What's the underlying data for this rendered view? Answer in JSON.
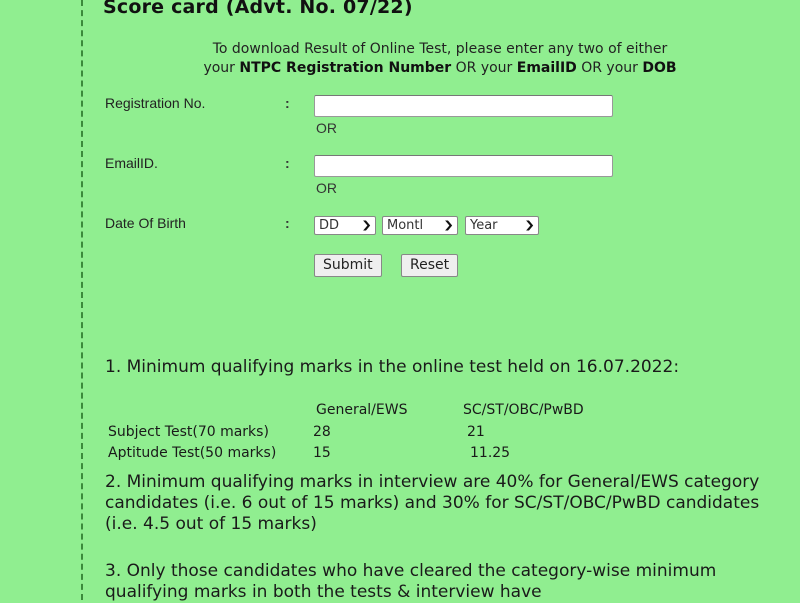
{
  "page": {
    "title": "Score card (Advt. No. 07/22)",
    "background_color": "#90ee90"
  },
  "instructions": {
    "line1": "To download Result of Online Test, please enter any two of either",
    "line2_parts": [
      "your ",
      "NTPC Registration Number",
      " OR your ",
      "EmailID",
      " OR your ",
      "DOB"
    ]
  },
  "form": {
    "registration": {
      "label": "Registration No.",
      "colon": ":",
      "value": "",
      "or": "OR"
    },
    "email": {
      "label": "EmailID.",
      "colon": ":",
      "value": "",
      "or": "OR"
    },
    "dob": {
      "label": "Date Of Birth",
      "colon": ":",
      "day_selected": "DD",
      "month_selected": "Montl",
      "year_selected": "Year"
    },
    "submit_label": "Submit",
    "reset_label": "Reset"
  },
  "notes": {
    "note1": {
      "text": "1. Minimum qualifying marks in the online test held on 16.07.2022:",
      "table": {
        "headers": [
          "",
          "General/EWS",
          "SC/ST/OBC/PwBD"
        ],
        "rows": [
          [
            "Subject Test(70 marks)",
            "28",
            "21"
          ],
          [
            "Aptitude Test(50 marks)",
            "15",
            "11.25"
          ]
        ]
      }
    },
    "note2": "2. Minimum qualifying marks in interview are 40% for General/EWS category candidates (i.e. 6 out of 15 marks) and 30% for SC/ST/OBC/PwBD candidates (i.e. 4.5 out of 15 marks)",
    "note3": "3. Only those candidates who have cleared the category-wise minimum qualifying marks in both the tests & interview have"
  },
  "icons": {
    "select_chevron": "chevron-down-icon"
  }
}
